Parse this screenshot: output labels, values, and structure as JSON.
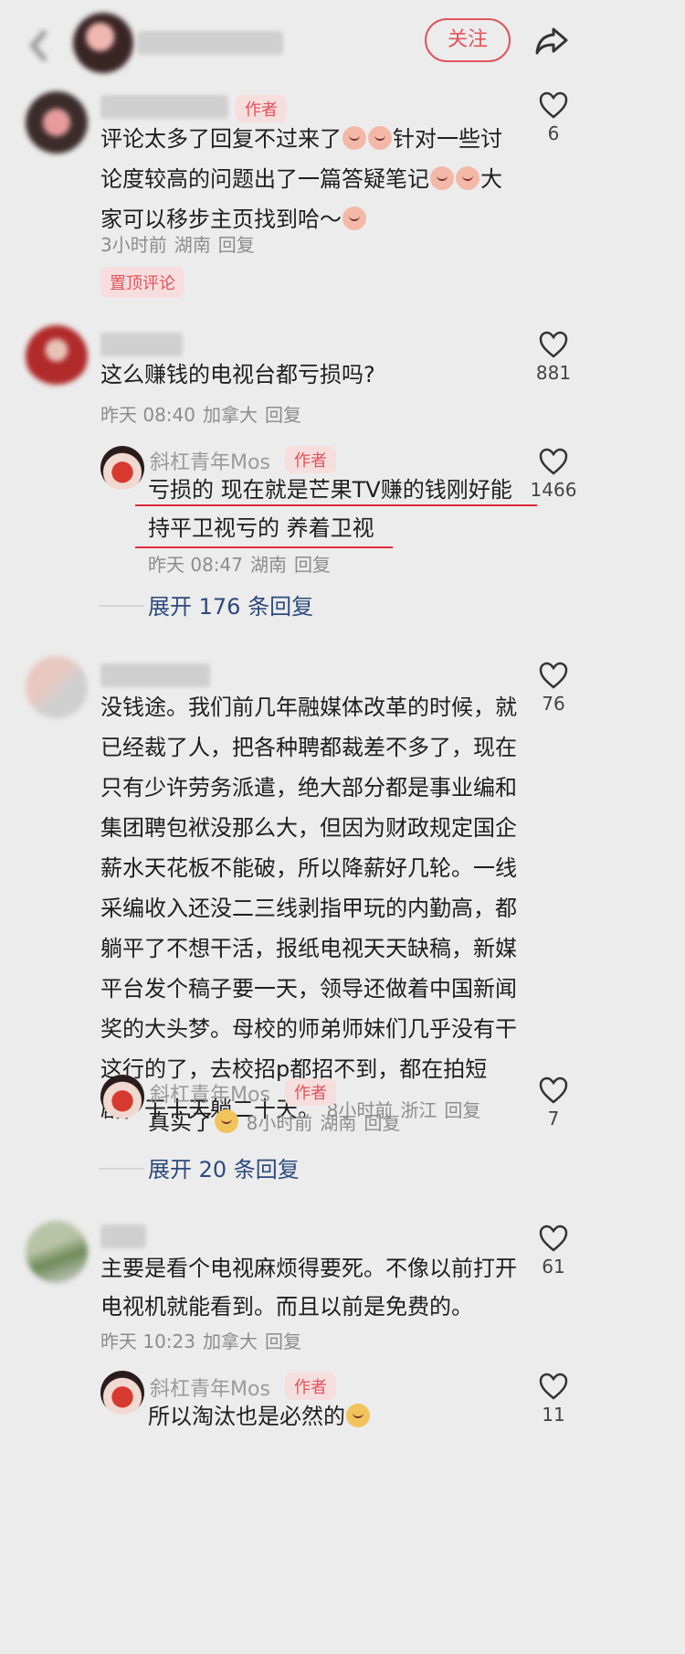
{
  "header": {
    "follow_label": "关注"
  },
  "comments": [
    {
      "tag": "作者",
      "text_parts": [
        "评论太多了回复不过来了",
        "针对一些讨论度较高的问题出了一篇答疑笔记",
        "大家可以移步主页找到哈～"
      ],
      "time": "3小时前",
      "location": "湖南",
      "reply_label": "回复",
      "pinned_label": "置顶评论",
      "likes": "6"
    },
    {
      "text": "这么赚钱的电视台都亏损吗?",
      "time": "昨天 08:40",
      "location": "加拿大",
      "reply_label": "回复",
      "likes": "881",
      "reply": {
        "name": "斜杠青年Mos",
        "tag": "作者",
        "line1": "亏损的 现在就是芒果TV赚的钱刚好能",
        "line2": "持平卫视亏的 养着卫视",
        "time": "昨天 08:47",
        "location": "湖南",
        "reply_label": "回复",
        "likes": "1466"
      },
      "expand_label": "展开 176 条回复"
    },
    {
      "lines": [
        "没钱途。我们前几年融媒体改革的时候，就",
        "已经裁了人，把各种聘都裁差不多了，现在",
        "只有少许劳务派遣，绝大部分都是事业编和",
        "集团聘包袱没那么大，但因为财政规定国企",
        "薪水天花板不能破，所以降薪好几轮。一线",
        "采编收入还没二三线剥指甲玩的内勤高，都",
        "躺平了不想干活，报纸电视天天缺稿，新媒",
        "平台发个稿子要一天，领导还做着中国新闻",
        "奖的大头梦。母校的师弟师妹们几乎没有干",
        "这行的了，去校招p都招不到，都在拍短"
      ],
      "last_line": "剧，干十天躺二十天。",
      "time": "8小时前",
      "location": "浙江",
      "reply_label": "回复",
      "likes": "76",
      "reply": {
        "name": "斜杠青年Mos",
        "tag": "作者",
        "text": "真实了",
        "time": "8小时前",
        "location": "湖南",
        "reply_label": "回复",
        "likes": "7"
      },
      "expand_label": "展开 20 条回复"
    },
    {
      "line1": "主要是看个电视麻烦得要死。不像以前打开",
      "line2": "电视机就能看到。而且以前是免费的。",
      "time": "昨天 10:23",
      "location": "加拿大",
      "reply_label": "回复",
      "likes": "61",
      "reply": {
        "name": "斜杠青年Mos",
        "tag": "作者",
        "text": "所以淘汰也是必然的",
        "likes": "11"
      }
    }
  ],
  "icons": {
    "back": "back-icon",
    "share": "share-icon",
    "heart": "heart-icon"
  },
  "colors": {
    "accent": "#e0545a",
    "link": "#2c4a7e",
    "underline": "#e22a3a"
  }
}
